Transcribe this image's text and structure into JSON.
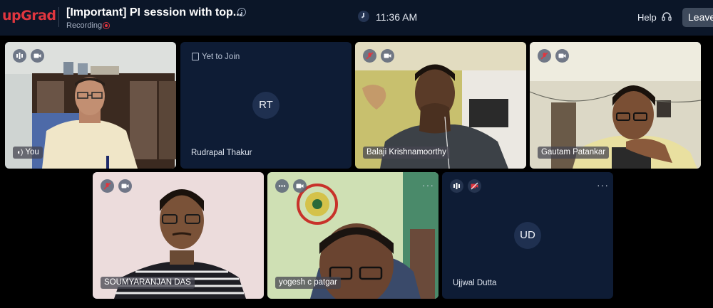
{
  "app": {
    "logo": "upGrad"
  },
  "header": {
    "title": "[Important] PI session with top...",
    "recording_label": "Recording",
    "time": "11:36 AM",
    "help_label": "Help",
    "leave_label": "Leave"
  },
  "participants": [
    {
      "name": "You",
      "status": "video"
    },
    {
      "name": "Rudrapal Thakur",
      "initials": "RT",
      "status": "Yet to Join"
    },
    {
      "name": "Balaji Krishnamoorthy",
      "status": "video"
    },
    {
      "name": "Gautam Patankar",
      "status": "video"
    },
    {
      "name": "SOUMYARANJAN DAS",
      "status": "video"
    },
    {
      "name": "yogesh c patgar",
      "status": "video"
    },
    {
      "name": "Ujjwal Dutta",
      "initials": "UD",
      "status": "camera off"
    }
  ],
  "colors": {
    "brand": "#e0363f",
    "bg": "#000000",
    "topbar": "#0b1628",
    "tile": "#0e1c35"
  }
}
